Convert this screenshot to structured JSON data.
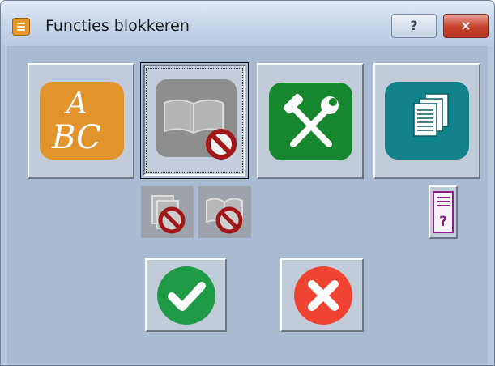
{
  "window": {
    "title": "Functies blokkeren",
    "help_label": "?",
    "close_label": "×"
  },
  "icons": {
    "spelling": "abc-spelling-icon",
    "dictionary_blocked": "book-blocked-icon",
    "tools": "hammer-wrench-icon",
    "documents": "pages-icon",
    "help_document": "document-question-icon",
    "ok": "checkmark-icon",
    "cancel": "x-icon"
  },
  "tile_text": {
    "spelling_line1": "A",
    "spelling_line2": "BC",
    "help_mark": "?"
  },
  "colors": {
    "spelling": "#e1942c",
    "dictionary": "#8e8e8e",
    "tools": "#16872e",
    "documents": "#12838a",
    "ok": "#1f9b47",
    "cancel": "#ef4432",
    "prohibition": "#a01818"
  }
}
